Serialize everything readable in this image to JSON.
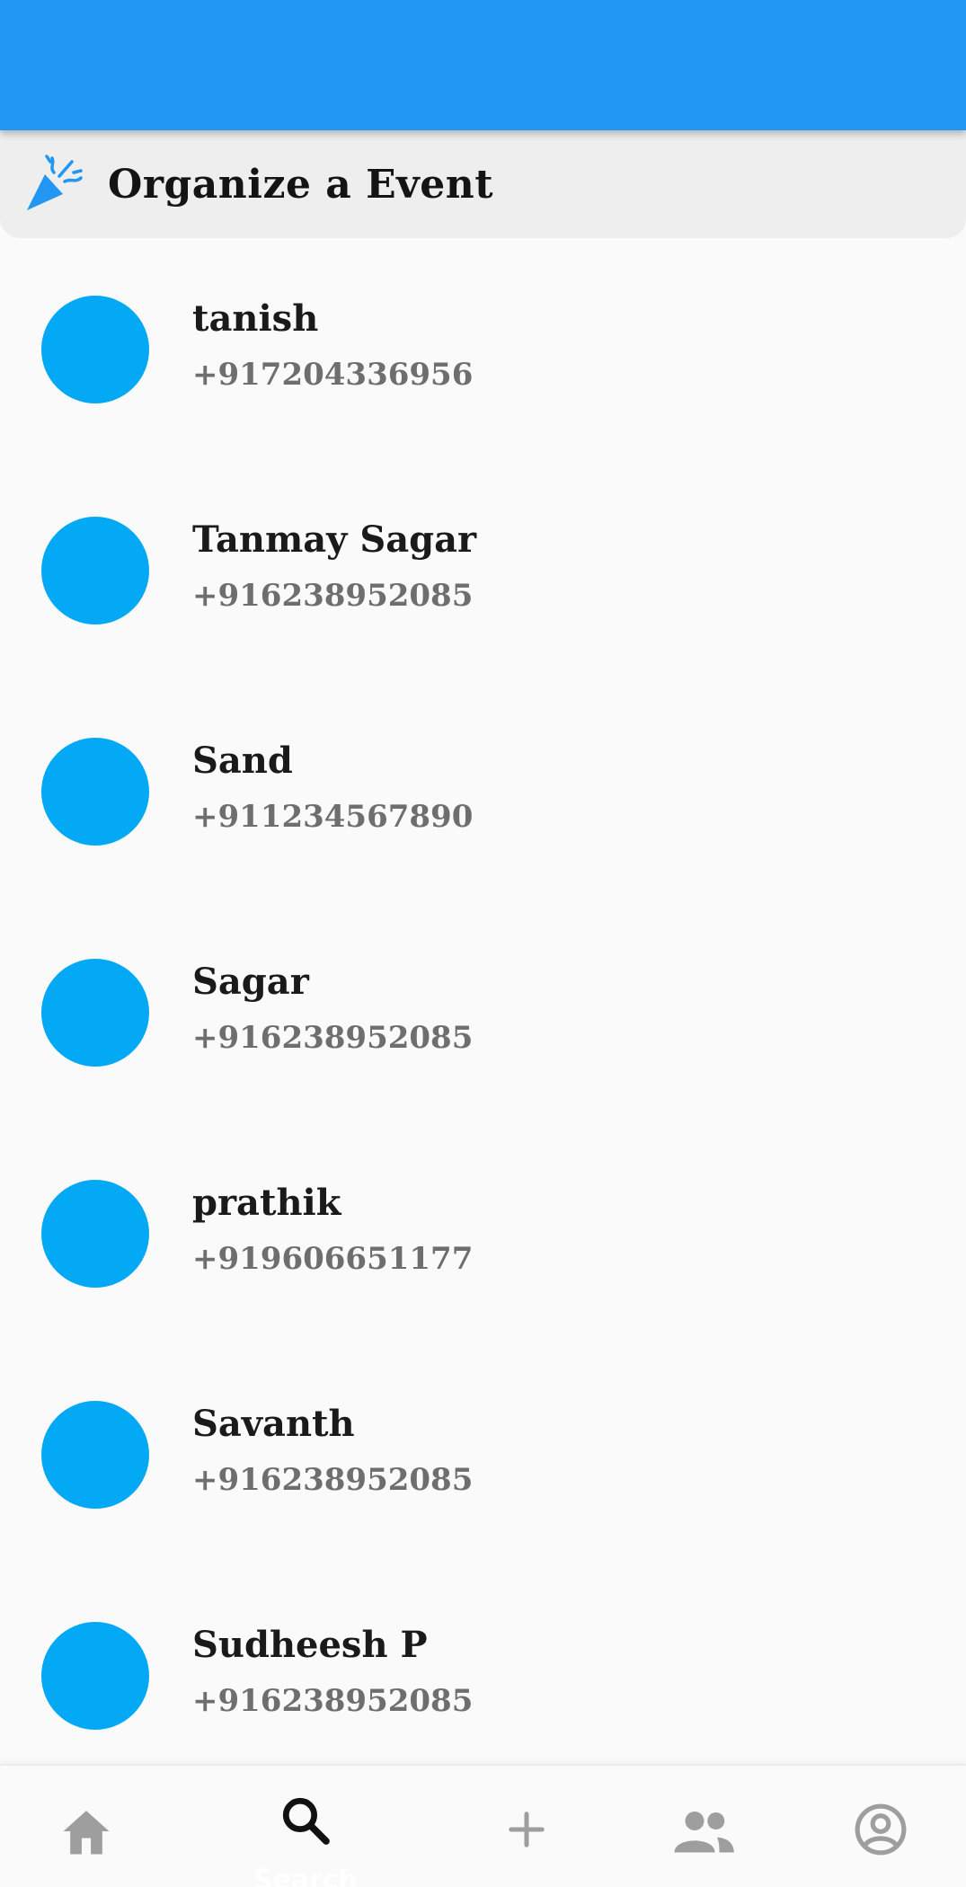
{
  "colors": {
    "app_bar": "#2196f3",
    "avatar": "#03a9f4",
    "card_bg": "#eeeeee",
    "nav_active": "#111111",
    "nav_inactive": "#9e9e9e"
  },
  "organize": {
    "icon": "party-popper-icon",
    "title": "Organize a Event"
  },
  "contacts": [
    {
      "name": "tanish",
      "phone": "+917204336956"
    },
    {
      "name": "Tanmay Sagar",
      "phone": "+916238952085"
    },
    {
      "name": "Sand",
      "phone": "+911234567890"
    },
    {
      "name": "Sagar",
      "phone": "+916238952085"
    },
    {
      "name": "prathik",
      "phone": "+919606651177"
    },
    {
      "name": "Savanth",
      "phone": "+916238952085"
    },
    {
      "name": "Sudheesh P",
      "phone": "+916238952085"
    }
  ],
  "bottom_nav": {
    "items": [
      {
        "icon": "home-icon",
        "active": false
      },
      {
        "icon": "search-icon",
        "label": "Search",
        "active": true
      },
      {
        "icon": "add-icon",
        "active": false
      },
      {
        "icon": "people-icon",
        "active": false
      },
      {
        "icon": "account-circle-icon",
        "active": false
      }
    ]
  }
}
